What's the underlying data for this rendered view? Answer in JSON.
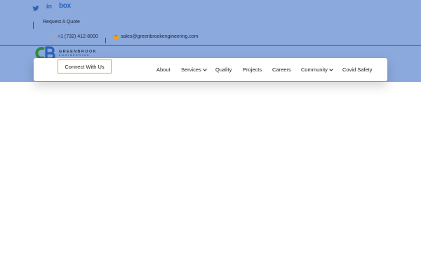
{
  "social": {
    "twitter_icon": "twitter-icon",
    "linkedin_label": "in",
    "box_label": "box"
  },
  "topbar": {
    "request_quote": "Request A Quote",
    "phone": "+1 (732) 412-8000",
    "email": "sales@greenbrookengineering.com"
  },
  "logo": {
    "name": "GREENBROOK",
    "sub": "ENGINEERING"
  },
  "header": {
    "cta_label": "Connect With Us"
  },
  "nav": {
    "items": [
      {
        "label": "About"
      },
      {
        "label": "Services"
      },
      {
        "label": "Quality"
      },
      {
        "label": "Projects"
      },
      {
        "label": "Careers"
      },
      {
        "label": "Community"
      },
      {
        "label": "Covid Safety"
      }
    ]
  },
  "colors": {
    "band": "#8ba9dc",
    "accent": "#e8a422",
    "brand_blue": "#2b63b7",
    "brand_green": "#2e8b3d"
  }
}
